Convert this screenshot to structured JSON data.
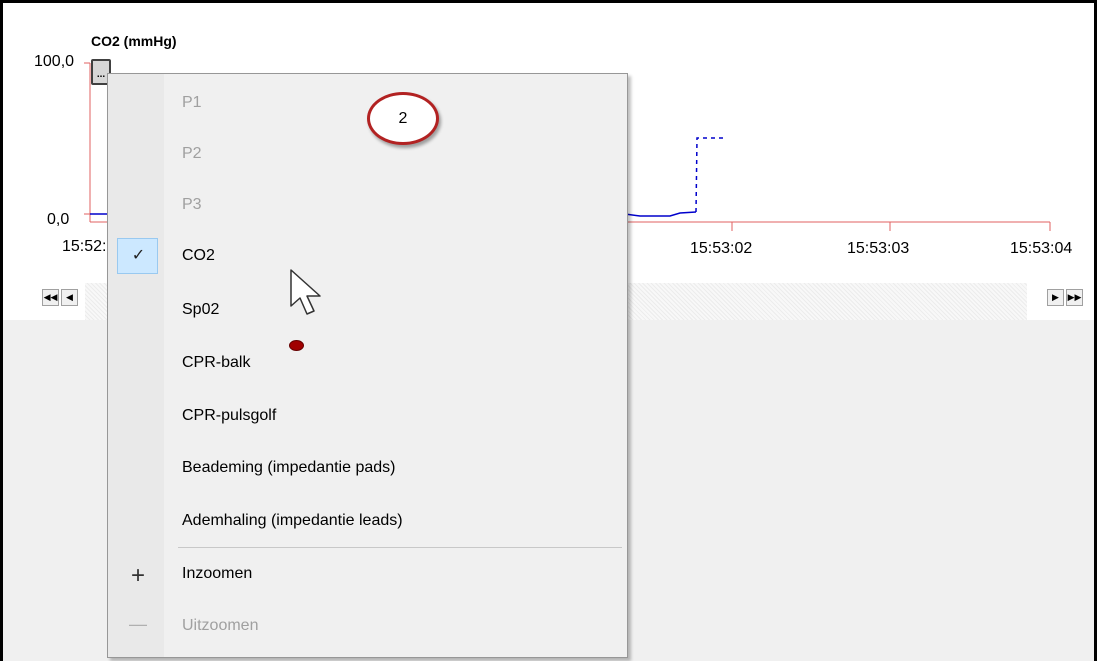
{
  "chart": {
    "title": "CO2 (mmHg)",
    "y_max_label": "100,0",
    "y_min_label": "0,0",
    "x_labels": [
      "15:52:",
      "15:53:02",
      "15:53:03",
      "15:53:04"
    ],
    "expand_button_label": "..."
  },
  "scrollbar": {
    "first_label": "◀◀",
    "prev_label": "◀",
    "next_label": "▶",
    "last_label": "▶▶"
  },
  "context_menu": {
    "items": [
      {
        "label": "P1",
        "enabled": false,
        "checked": false
      },
      {
        "label": "P2",
        "enabled": false,
        "checked": false
      },
      {
        "label": "P3",
        "enabled": false,
        "checked": false
      },
      {
        "label": "CO2",
        "enabled": true,
        "checked": true
      },
      {
        "label": "Sp02",
        "enabled": true,
        "checked": false
      },
      {
        "label": "CPR-balk",
        "enabled": true,
        "checked": false
      },
      {
        "label": "CPR-pulsgolf",
        "enabled": true,
        "checked": false
      },
      {
        "label": "Beademing (impedantie pads)",
        "enabled": true,
        "checked": false
      },
      {
        "label": "Ademhaling (impedantie leads)",
        "enabled": true,
        "checked": false
      }
    ],
    "zoom_items": [
      {
        "label": "Inzoomen",
        "icon": "plus-icon",
        "enabled": true
      },
      {
        "label": "Uitzoomen",
        "icon": "minus-icon",
        "enabled": false
      }
    ],
    "check_mark": "✓",
    "plus_glyph": "+",
    "minus_glyph": "—"
  },
  "annotation": {
    "callout_number": "2"
  },
  "colors": {
    "axis": "#e06060",
    "trace": "#0000cc",
    "callout_border": "#b22222",
    "check_highlight": "#cce8ff"
  }
}
